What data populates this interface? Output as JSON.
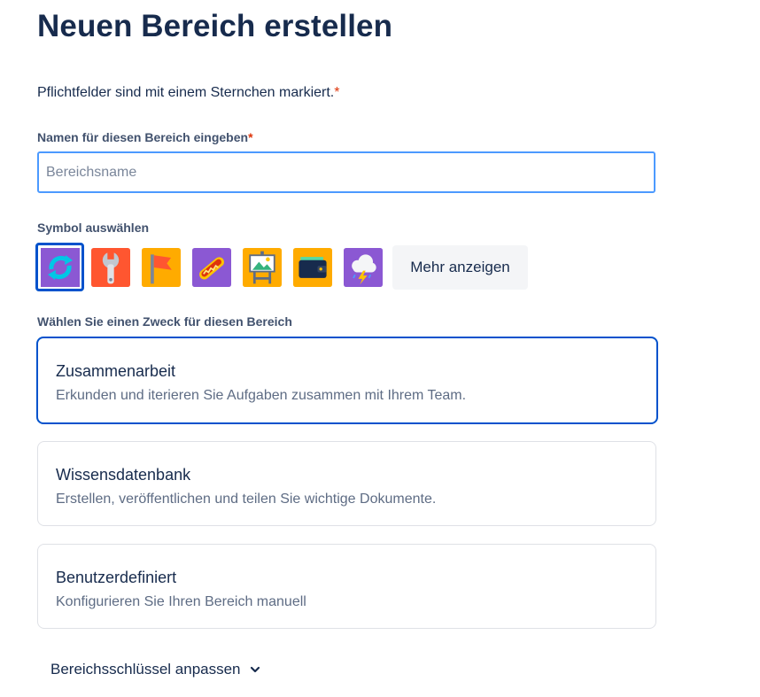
{
  "page": {
    "title": "Neuen Bereich erstellen",
    "required_note": "Pflichtfelder sind mit einem Sternchen markiert.",
    "asterisk": "*"
  },
  "name_field": {
    "label": "Namen für diesen Bereich eingeben",
    "placeholder": "Bereichsname",
    "value": ""
  },
  "symbol_picker": {
    "label": "Symbol auswählen",
    "icons": [
      "sync-arrows-icon",
      "wrench-icon",
      "flag-icon",
      "hotdog-icon",
      "easel-picture-icon",
      "wallet-icon",
      "storm-cloud-icon"
    ],
    "selected_index": 0,
    "more_label": "Mehr anzeigen"
  },
  "purpose": {
    "label": "Wählen Sie einen Zweck für diesen Bereich",
    "options": [
      {
        "title": "Zusammenarbeit",
        "description": "Erkunden und iterieren Sie Aufgaben zusammen mit Ihrem Team.",
        "selected": true
      },
      {
        "title": "Wissensdatenbank",
        "description": "Erstellen, veröffentlichen und teilen Sie wichtige Dokumente.",
        "selected": false
      },
      {
        "title": "Benutzerdefiniert",
        "description": "Konfigurieren Sie Ihren Bereich manuell",
        "selected": false
      }
    ]
  },
  "key_toggle": {
    "label": "Bereichsschlüssel anpassen",
    "icon": "chevron-down-icon"
  },
  "colors": {
    "accent": "#0052cc",
    "focus_border": "#4c9aff",
    "required": "#de350b",
    "text": "#172b4d",
    "subtle_text": "#5e6c84"
  }
}
